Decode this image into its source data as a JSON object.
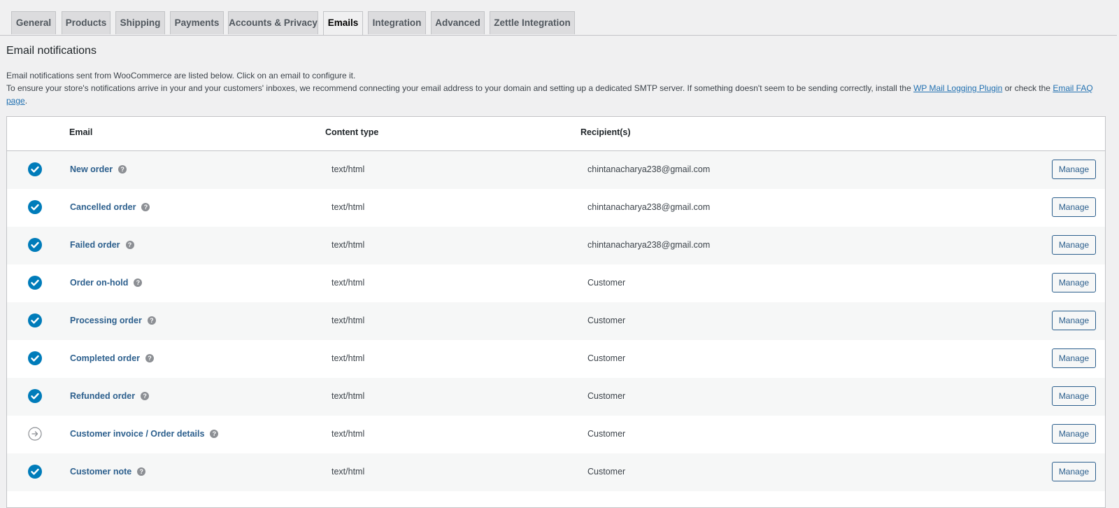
{
  "tabs": [
    {
      "label": "General",
      "active": false
    },
    {
      "label": "Products",
      "active": false
    },
    {
      "label": "Shipping",
      "active": false
    },
    {
      "label": "Payments",
      "active": false
    },
    {
      "label": "Accounts & Privacy",
      "active": false
    },
    {
      "label": "Emails",
      "active": true
    },
    {
      "label": "Integration",
      "active": false
    },
    {
      "label": "Advanced",
      "active": false
    },
    {
      "label": "Zettle Integration",
      "active": false
    }
  ],
  "page_title": "Email notifications",
  "description": {
    "line1": "Email notifications sent from WooCommerce are listed below. Click on an email to configure it.",
    "line2_prefix": "To ensure your store's notifications arrive in your and your customers' inboxes, we recommend connecting your email address to your domain and setting up a dedicated SMTP server. If something doesn't seem to be sending correctly, install the ",
    "link1": "WP Mail Logging Plugin",
    "line2_middle": " or check the ",
    "link2": "Email FAQ page",
    "line2_suffix": "."
  },
  "table": {
    "headers": {
      "email": "Email",
      "content_type": "Content type",
      "recipients": "Recipient(s)"
    },
    "manage_label": "Manage",
    "help_glyph": "?",
    "rows": [
      {
        "name": "New order",
        "status": "enabled",
        "content_type": "text/html",
        "recipient": "chintanacharya238@gmail.com"
      },
      {
        "name": "Cancelled order",
        "status": "enabled",
        "content_type": "text/html",
        "recipient": "chintanacharya238@gmail.com"
      },
      {
        "name": "Failed order",
        "status": "enabled",
        "content_type": "text/html",
        "recipient": "chintanacharya238@gmail.com"
      },
      {
        "name": "Order on-hold",
        "status": "enabled",
        "content_type": "text/html",
        "recipient": "Customer"
      },
      {
        "name": "Processing order",
        "status": "enabled",
        "content_type": "text/html",
        "recipient": "Customer"
      },
      {
        "name": "Completed order",
        "status": "enabled",
        "content_type": "text/html",
        "recipient": "Customer"
      },
      {
        "name": "Refunded order",
        "status": "enabled",
        "content_type": "text/html",
        "recipient": "Customer"
      },
      {
        "name": "Customer invoice / Order details",
        "status": "manual",
        "content_type": "text/html",
        "recipient": "Customer"
      },
      {
        "name": "Customer note",
        "status": "enabled",
        "content_type": "text/html",
        "recipient": "Customer"
      }
    ]
  },
  "colors": {
    "accent": "#2271b1",
    "status_enabled": "#007cba",
    "link": "#2c5f8d"
  }
}
